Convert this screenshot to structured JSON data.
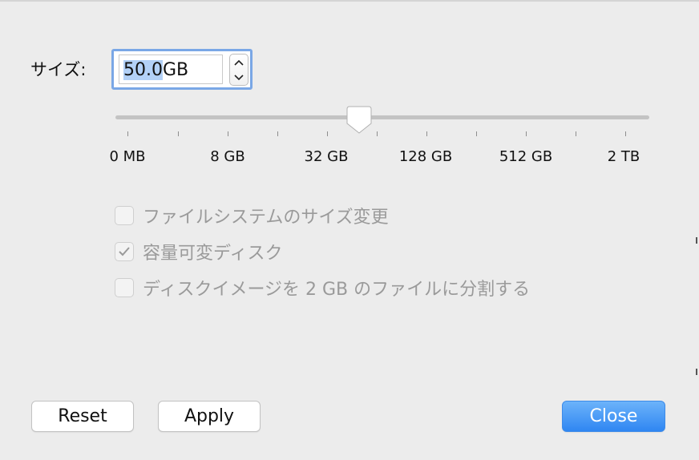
{
  "size": {
    "label": "サイズ:",
    "value_selected": "50.0",
    "value_unit": "GB"
  },
  "slider": {
    "value_label": "50.0GB",
    "ticks": [
      "0 MB",
      "8 GB",
      "32 GB",
      "128 GB",
      "512 GB",
      "2 TB"
    ]
  },
  "options": {
    "resize_fs": {
      "label": "ファイルシステムのサイズ変更",
      "checked": false,
      "enabled": false
    },
    "sparse": {
      "label": "容量可変ディスク",
      "checked": true,
      "enabled": false
    },
    "split": {
      "label": "ディスクイメージを 2 GB のファイルに分割する",
      "checked": false,
      "enabled": false
    }
  },
  "buttons": {
    "reset": "Reset",
    "apply": "Apply",
    "close": "Close"
  },
  "colors": {
    "focus_ring": "#7aa7e6",
    "selection": "#b3d1f7",
    "primary": "#2f86f2",
    "disabled_text": "#9a9a9a"
  }
}
